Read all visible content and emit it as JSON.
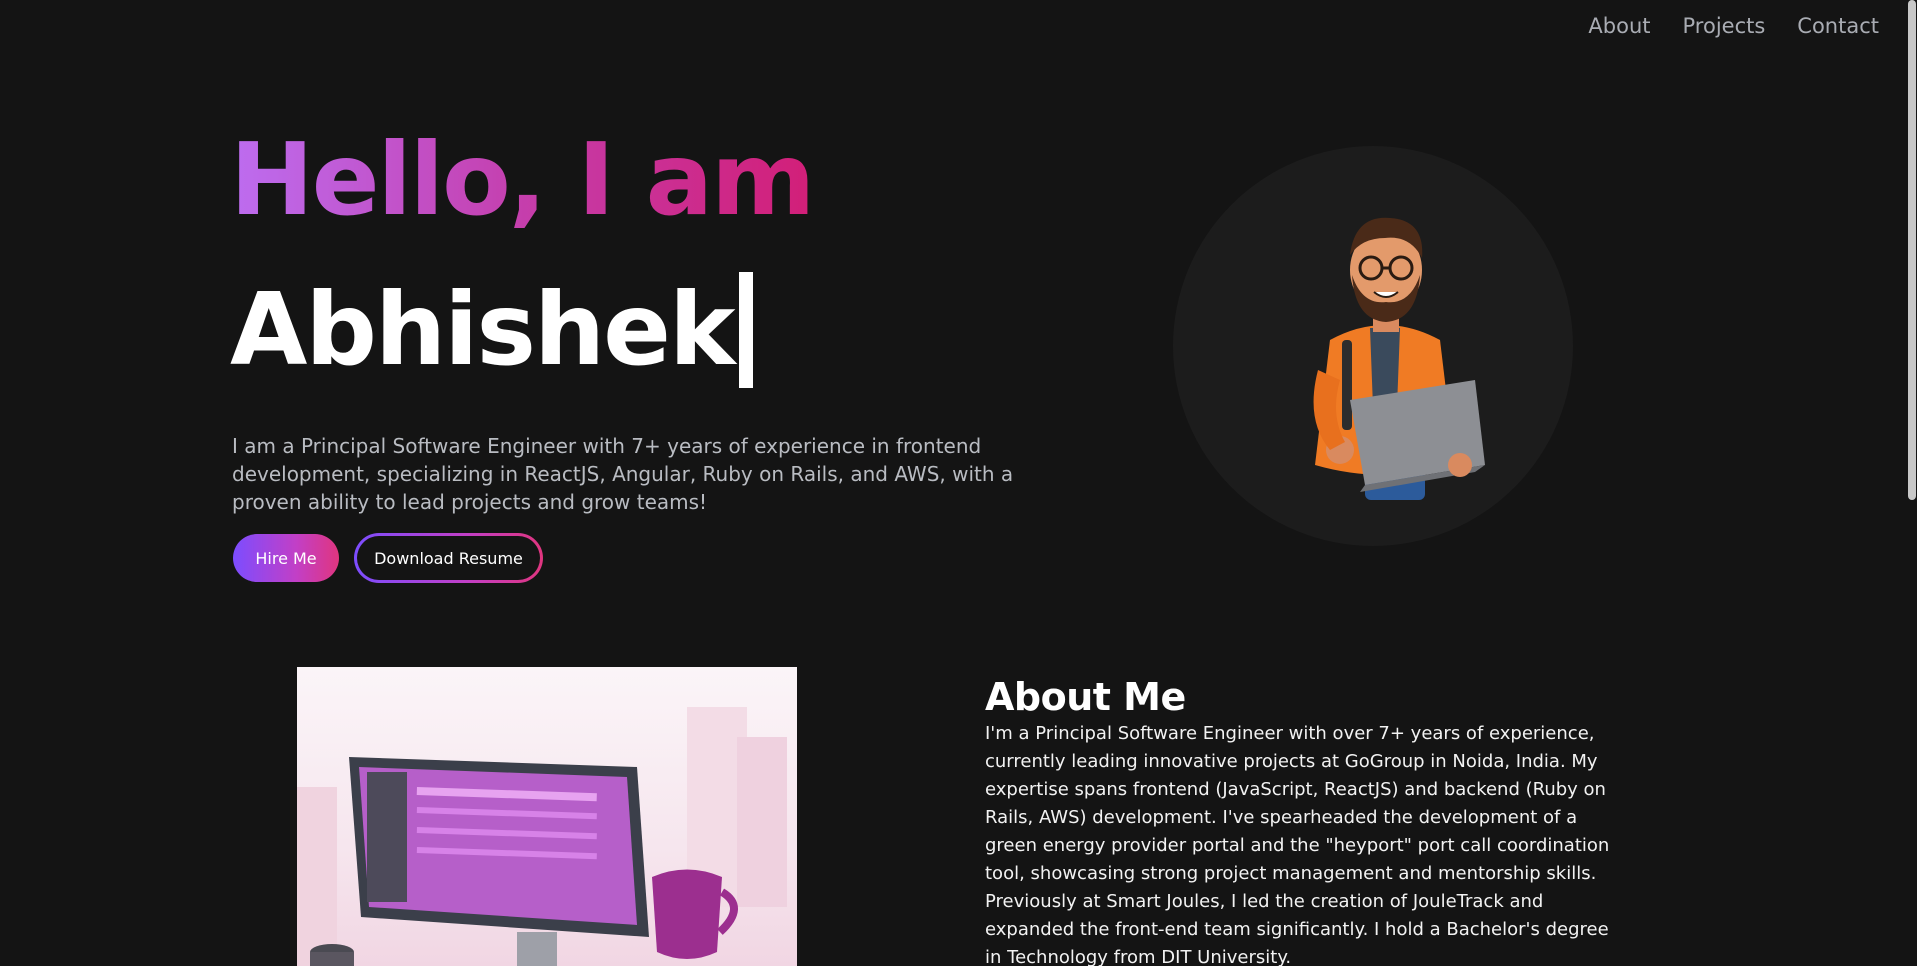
{
  "nav": {
    "items": [
      "About",
      "Projects",
      "Contact"
    ]
  },
  "hero": {
    "greeting": "Hello, I am",
    "name": "Abhishek",
    "intro": "I am a Principal Software Engineer with 7+ years of experience in frontend development, specializing in ReactJS, Angular, Ruby on Rails, and AWS, with a proven ability to lead projects and grow teams!",
    "hire_label": "Hire Me",
    "resume_label": "Download Resume"
  },
  "about": {
    "title": "About Me",
    "text": "I'm a Principal Software Engineer with over 7+ years of experience, currently leading innovative projects at GoGroup in Noida, India. My expertise spans frontend (JavaScript, ReactJS) and backend (Ruby on Rails, AWS) development. I've spearheaded the development of a green energy provider portal and the \"heyport\" port call coordination tool, showcasing strong project management and mentorship skills. Previously at Smart Joules, I led the creation of JouleTrack and expanded the front-end team significantly. I hold a Bachelor's degree in Technology from DIT University."
  },
  "colors": {
    "background": "#141414",
    "accent_purple": "#7c4dff",
    "accent_pink": "#e0357f",
    "nav_text": "#a9acb3"
  },
  "icons": {
    "avatar": "developer-avatar-illustration",
    "about_image": "workspace-illustration"
  }
}
